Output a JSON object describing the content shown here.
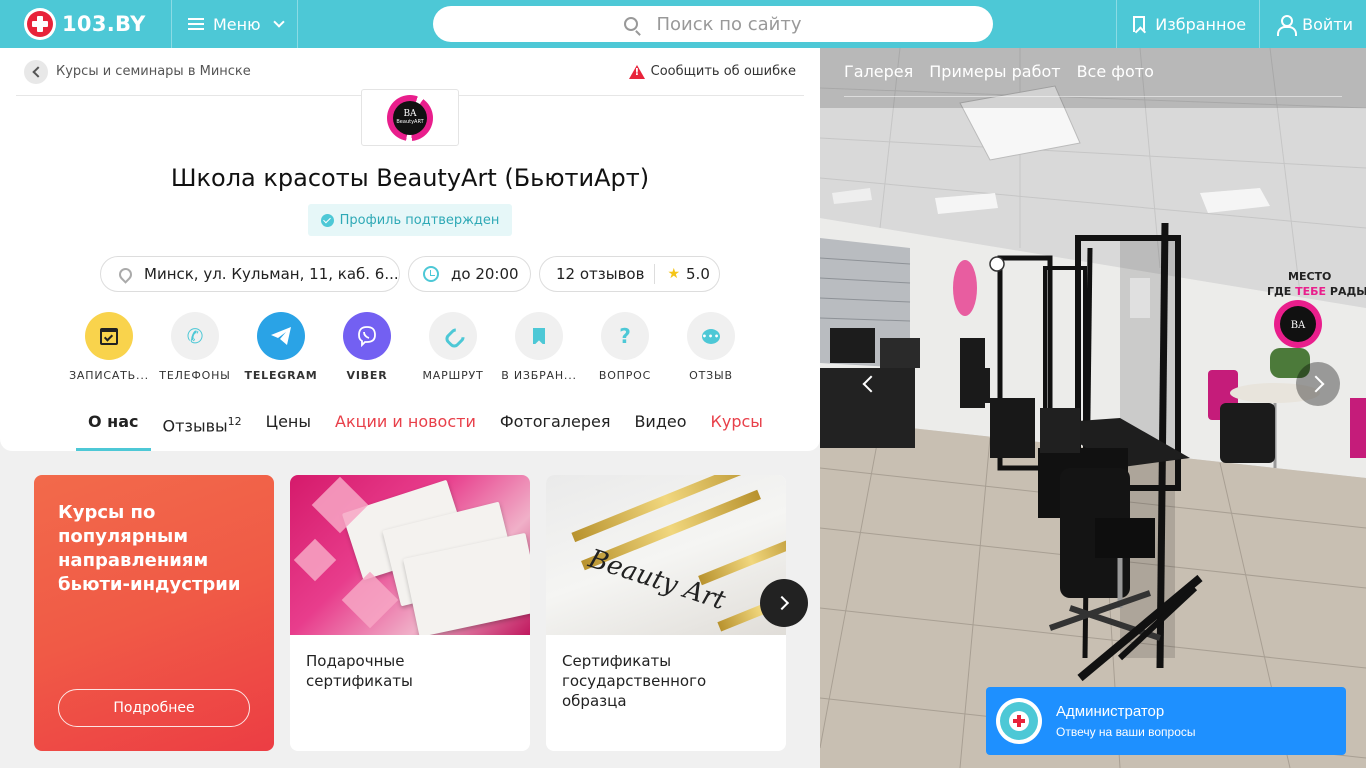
{
  "header": {
    "logo_text": "103.BY",
    "menu_label": "Меню",
    "search_placeholder": "Поиск по сайту",
    "favorites_label": "Избранное",
    "login_label": "Войти"
  },
  "breadcrumb": {
    "label": "Курсы и семинары в Минске",
    "report_label": "Сообщить об ошибке"
  },
  "company": {
    "logo_monogram": "BA",
    "logo_text": "BeautyART",
    "title": "Школа красоты BeautyArt (БьютиАрт)",
    "verified_label": "Профиль подтвержден",
    "address": "Минск, ул. Кульман, 11, каб. 6...",
    "hours": "до 20:00",
    "reviews_label": "12 отзывов",
    "rating": "5.0"
  },
  "actions": [
    {
      "label": "ЗАПИСАТЬ...",
      "icon": "calendar-check-icon"
    },
    {
      "label": "ТЕЛЕФОНЫ",
      "icon": "phone-icon"
    },
    {
      "label": "TELEGRAM",
      "icon": "telegram-icon"
    },
    {
      "label": "VIBER",
      "icon": "viber-icon"
    },
    {
      "label": "МАРШРУТ",
      "icon": "route-icon"
    },
    {
      "label": "В ИЗБРАН...",
      "icon": "bookmark-icon"
    },
    {
      "label": "ВОПРОС",
      "icon": "question-icon"
    },
    {
      "label": "ОТЗЫВ",
      "icon": "chat-bubble-icon"
    }
  ],
  "tabs": [
    {
      "label": "О нас",
      "active": true
    },
    {
      "label": "Отзывы",
      "count": "12"
    },
    {
      "label": "Цены"
    },
    {
      "label": "Акции и новости",
      "highlight": true
    },
    {
      "label": "Фотогалерея"
    },
    {
      "label": "Видео"
    },
    {
      "label": "Курсы",
      "highlight": true
    }
  ],
  "promo": {
    "title": "Курсы по популярным направлениям бьюти-индустрии",
    "button_label": "Подробнее"
  },
  "cards": [
    {
      "caption": "Подарочные сертификаты"
    },
    {
      "caption": "Сертификаты государственного образца"
    }
  ],
  "gallery": {
    "tabs": [
      "Галерея",
      "Примеры работ",
      "Все фото"
    ],
    "wall_text_line1": "МЕСТО",
    "wall_text_line2_a": "ГДЕ ",
    "wall_text_line2_b": "ТЕБЕ",
    "wall_text_line2_c": " РАДЫ",
    "wall_logo": "BA"
  },
  "chat": {
    "name": "Администратор",
    "subtitle": "Отвечу на ваши вопросы"
  },
  "colors": {
    "accent": "#4dc8d6",
    "brand_red": "#e8233a",
    "link_red": "#e8404a",
    "chat_blue": "#1e90ff"
  }
}
